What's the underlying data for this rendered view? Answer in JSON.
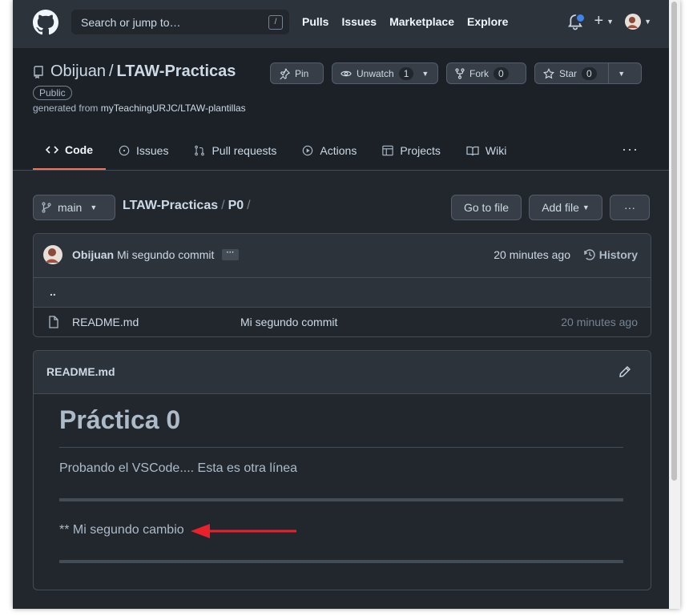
{
  "header": {
    "search_placeholder": "Search or jump to…",
    "slash_hint": "/",
    "nav": [
      "Pulls",
      "Issues",
      "Marketplace",
      "Explore"
    ]
  },
  "repo": {
    "owner": "Obijuan",
    "separator": "/",
    "name": "LTAW-Practicas",
    "visibility": "Public",
    "generated_prefix": "generated from ",
    "template": "myTeachingURJC/LTAW-plantillas",
    "pin_label": "Pin",
    "unwatch_label": "Unwatch",
    "unwatch_count": "1",
    "fork_label": "Fork",
    "fork_count": "0",
    "star_label": "Star",
    "star_count": "0"
  },
  "tabs": [
    {
      "label": "Code"
    },
    {
      "label": "Issues"
    },
    {
      "label": "Pull requests"
    },
    {
      "label": "Actions"
    },
    {
      "label": "Projects"
    },
    {
      "label": "Wiki"
    }
  ],
  "tabs_more": "···",
  "files": {
    "branch": "main",
    "breadcrumb_repo": "LTAW-Practicas",
    "breadcrumb_sep": "/",
    "breadcrumb_dir": "P0",
    "go_to_file": "Go to file",
    "add_file": "Add file",
    "more": "···"
  },
  "commit": {
    "author": "Obijuan",
    "message": "Mi segundo commit",
    "ellipsis": "···",
    "ago": "20 minutes ago",
    "history_label": "History"
  },
  "rows": {
    "parent": "..",
    "file_name": "README.md",
    "file_message": "Mi segundo commit",
    "file_ago": "20 minutes ago"
  },
  "readme": {
    "title": "README.md",
    "h1": "Práctica 0",
    "p1": "Probando el VSCode.... Esta es otra línea",
    "p2": "** Mi segundo cambio"
  },
  "colors": {
    "bg": "#22272e",
    "header_bg": "#2d333b",
    "accent_tab": "#ec775c",
    "annotation_arrow": "#e8212a"
  }
}
